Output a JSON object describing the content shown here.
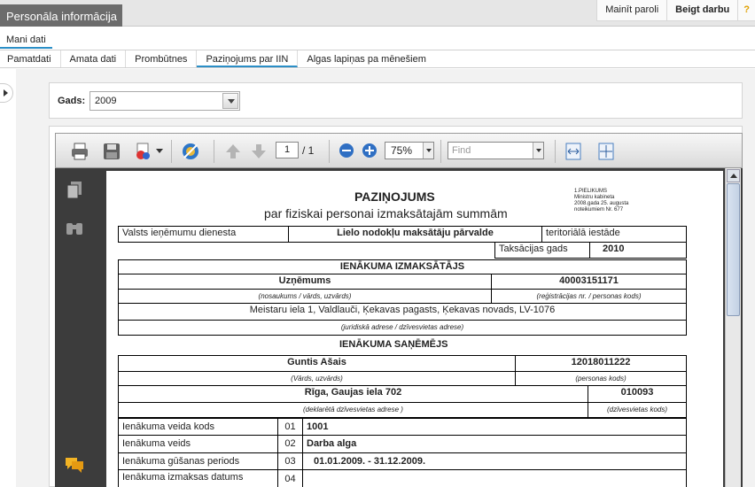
{
  "app": {
    "tab": "Personāla informācija"
  },
  "top_links": {
    "change_password": "Mainīt paroli",
    "logout": "Beigt darbu",
    "help": "?"
  },
  "subnav": {
    "my_data": "Mani dati"
  },
  "tabs": [
    "Pamatdati",
    "Amata dati",
    "Prombūtnes",
    "Paziņojums par IIN",
    "Algas lapiņas pa mēnešiem"
  ],
  "year": {
    "label": "Gads:",
    "value": "2009"
  },
  "viewer": {
    "page_current": "1",
    "page_total": "/ 1",
    "zoom": "75%",
    "find_placeholder": "Find"
  },
  "document": {
    "title": "PAZIŅOJUMS",
    "subtitle": "par fiziskai personai izmaksātajām summām",
    "annex": [
      "1.PIELIKUMS",
      "Ministru kabineta",
      "2008.gada 25. augusta",
      "noteikumiem Nr. 677"
    ],
    "header_row": {
      "vid": "Valsts ieņēmumu dienesta",
      "unit": "Lielo nodokļu maksātāju pārvalde",
      "office": "teritoriālā iestāde"
    },
    "tax_year_label": "Taksācijas gads",
    "tax_year": "2010",
    "payer_heading": "IENĀKUMA IZMAKSĀTĀJS",
    "payer_name": "Uzņēmums",
    "payer_reg": "40003151171",
    "payer_name_caption": "(nosaukums / vārds, uzvārds)",
    "payer_reg_caption": "(reģistrācijas nr. / personas kods)",
    "payer_address": "Meistaru iela 1, Valdlauči, Ķekavas pagasts, Ķekavas novads, LV-1076",
    "payer_address_caption": "(juridiskā adrese / dzīvesvietas adrese)",
    "recipient_heading": "IENĀKUMA SAŅĒMĒJS",
    "recipient_name": "Guntis Ašais",
    "recipient_code": "12018011222",
    "recipient_name_caption": "(Vārds, uzvārds)",
    "recipient_code_caption": "(personas kods)",
    "recipient_address": "Rīga, Gaujas iela 702",
    "recipient_post": "010093",
    "recipient_address_caption": "(deklarētā dzīvesvietas adrese )",
    "recipient_post_caption": "(dzīvesvietas kods)",
    "rows": [
      {
        "label": "Ienākuma veida kods",
        "num": "01",
        "value": "1001"
      },
      {
        "label": "Ienākuma veids",
        "num": "02",
        "value": "Darba alga"
      },
      {
        "label": "Ienākuma gūšanas periods",
        "num": "03",
        "value": "01.01.2009.   -   31.12.2009."
      },
      {
        "label": "Ienākuma izmaksas datums",
        "num": "04",
        "value": ""
      }
    ]
  }
}
